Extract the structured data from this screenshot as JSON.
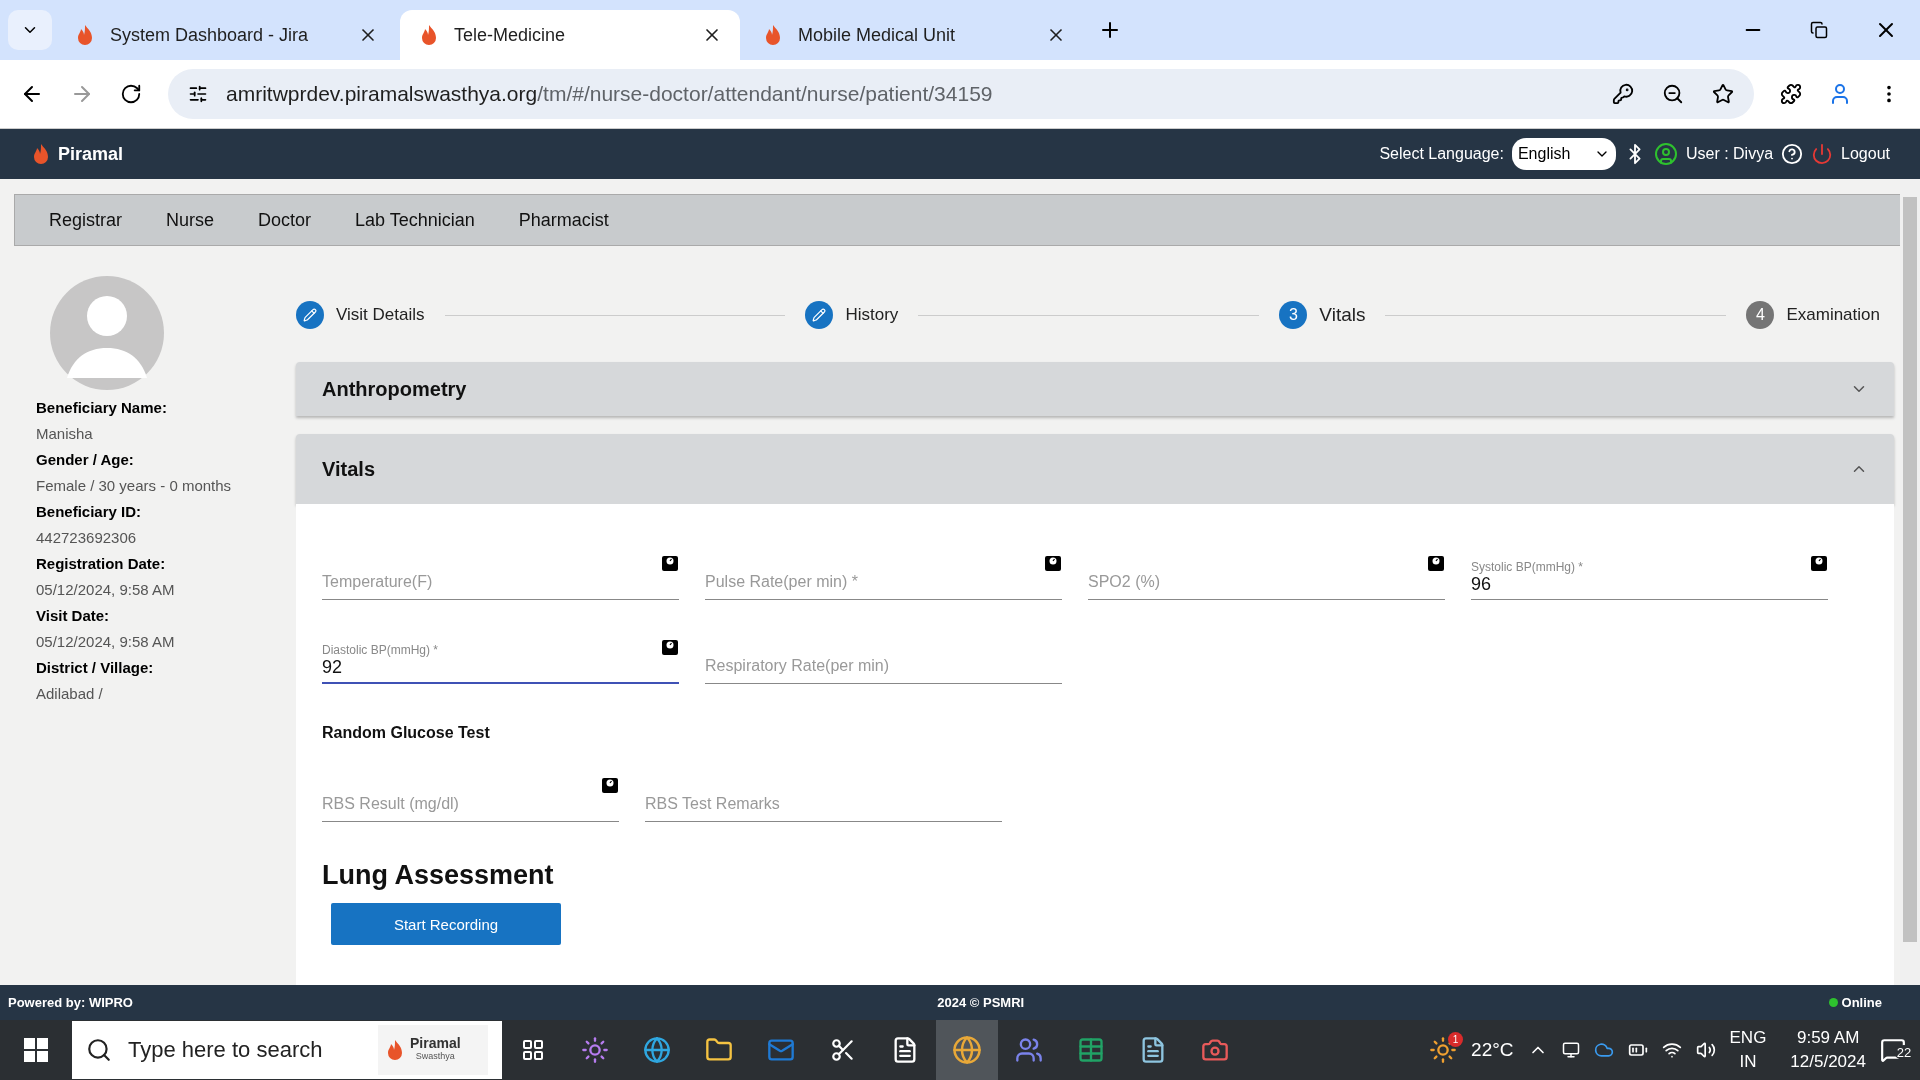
{
  "browser": {
    "tabs": [
      {
        "title": "System Dashboard - Jira",
        "selected": false
      },
      {
        "title": "Tele-Medicine",
        "selected": true
      },
      {
        "title": "Mobile Medical Unit",
        "selected": false
      }
    ],
    "url_host": "amritwprdev.piramalswasthya.org",
    "url_path": "/tm/#/nurse-doctor/attendant/nurse/patient/34159"
  },
  "header": {
    "logo": "Piramal",
    "language_label": "Select Language:",
    "language": "English",
    "user": "User : Divya",
    "logout": "Logout"
  },
  "nav": [
    {
      "label": "Registrar"
    },
    {
      "label": "Nurse"
    },
    {
      "label": "Doctor"
    },
    {
      "label": "Lab Technician"
    },
    {
      "label": "Pharmacist"
    }
  ],
  "beneficiary": [
    {
      "label": "Beneficiary Name:",
      "value": "Manisha"
    },
    {
      "label": "Gender / Age:",
      "value": "Female / 30 years - 0 months"
    },
    {
      "label": "Beneficiary ID:",
      "value": "442723692306"
    },
    {
      "label": "Registration Date:",
      "value": "05/12/2024, 9:58 AM"
    },
    {
      "label": "Visit Date:",
      "value": "05/12/2024, 9:58 AM"
    },
    {
      "label": "District / Village:",
      "value": "Adilabad /"
    }
  ],
  "stepper": [
    {
      "kind": "done",
      "label": "Visit Details"
    },
    {
      "kind": "done",
      "label": "History"
    },
    {
      "kind": "current",
      "number": "3",
      "label": "Vitals"
    },
    {
      "kind": "pending",
      "number": "4",
      "label": "Examination"
    }
  ],
  "sections": [
    {
      "title": "Anthropometry",
      "expanded": false
    },
    {
      "title": "Vitals",
      "expanded": true
    }
  ],
  "vitals_rows": [
    [
      {
        "label": "Temperature(F)",
        "kind": "measured",
        "focused": false
      },
      {
        "label": "Pulse Rate(per min) *",
        "kind": "measured",
        "focused": false
      },
      {
        "label": "SPO2 (%)",
        "kind": "measured",
        "focused": false
      },
      {
        "label": "Systolic BP(mmHg) *",
        "value": "96",
        "kind": "measured",
        "focused": false
      }
    ],
    [
      {
        "label": "Diastolic BP(mmHg) *",
        "value": "92",
        "kind": "measured",
        "focused": true
      },
      {
        "label": "Respiratory Rate(per min)",
        "kind": "plain",
        "focused": false
      }
    ]
  ],
  "glucose": {
    "title": "Random Glucose Test",
    "fields": [
      {
        "label": "RBS Result (mg/dl)",
        "kind": "measured",
        "focused": false
      },
      {
        "label": "RBS Test Remarks",
        "kind": "plain",
        "focused": false
      }
    ]
  },
  "lung": {
    "title": "Lung Assessment",
    "button": "Start Recording"
  },
  "footer": {
    "left": "Powered by: WIPRO",
    "center": "2024 © PSMRI",
    "status": "Online"
  },
  "taskbar": {
    "search": "Type here to search",
    "search_logo": "Piramal",
    "search_logo_sub": "Swasthya",
    "weather_badge": "1",
    "temperature": "22°C",
    "lang": "ENG",
    "region": "IN",
    "time": "9:59 AM",
    "date": "12/5/2024",
    "notifications": "22"
  }
}
